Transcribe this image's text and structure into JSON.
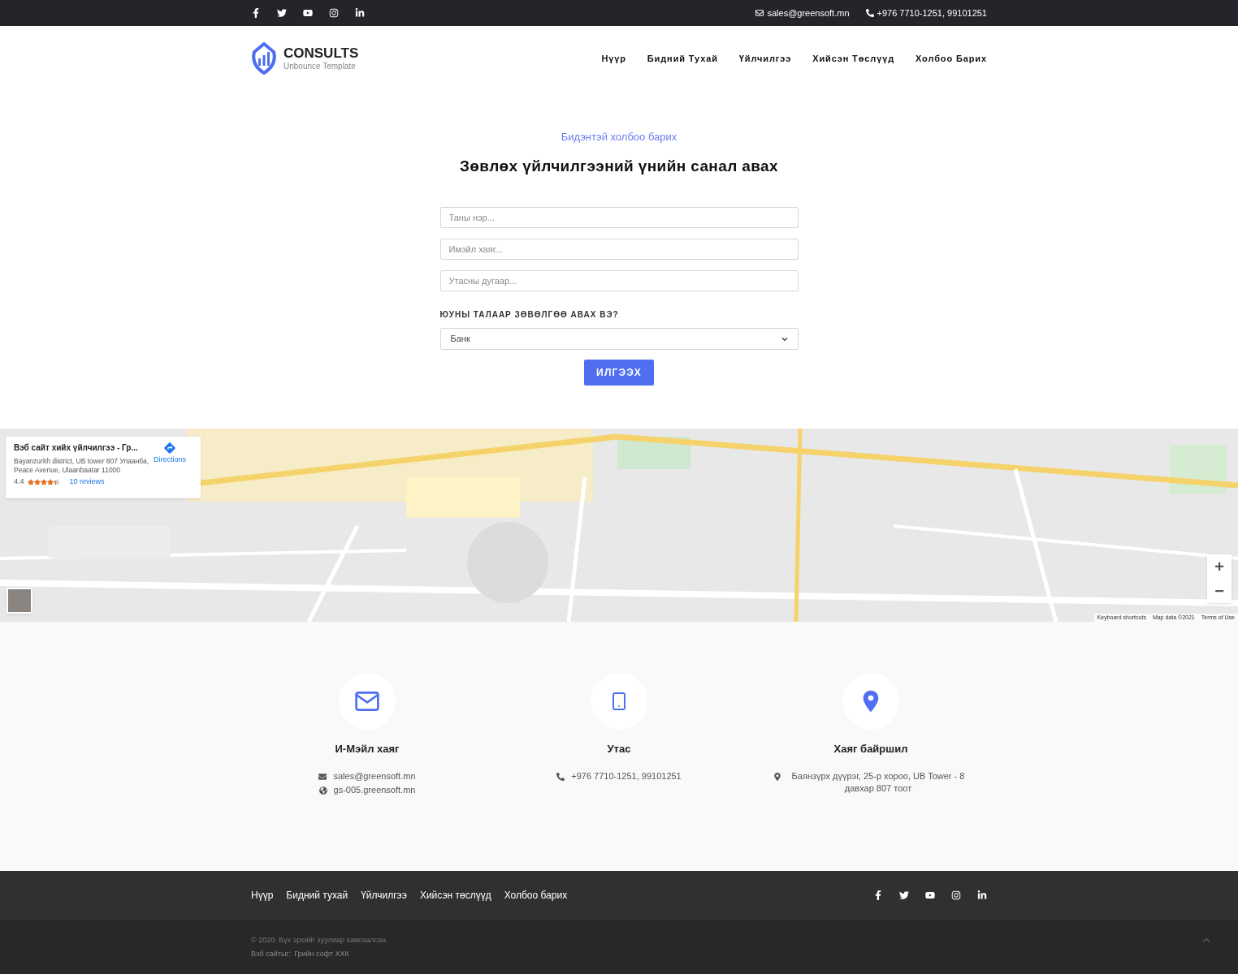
{
  "topbar": {
    "social": [
      {
        "kind": "facebook"
      },
      {
        "kind": "twitter"
      },
      {
        "kind": "youtube"
      },
      {
        "kind": "instagram"
      },
      {
        "kind": "linkedin"
      }
    ],
    "email": "sales@greensoft.mn",
    "phone": "+976 7710-1251, 99101251"
  },
  "header": {
    "logo_title": "CONSULTS",
    "logo_subtitle": "Unbounce Template",
    "nav": [
      "Нүүр",
      "Бидний Тухай",
      "Үйлчилгээ",
      "Хийсэн Төслүүд",
      "Холбоо Барих"
    ]
  },
  "form": {
    "eyebrow": "Бидэнтэй холбоо барих",
    "title": "Зөвлөх үйлчилгээний үнийн санал авах",
    "fields": [
      {
        "placeholder": "Таны нэр..."
      },
      {
        "placeholder": "Имэйл хаяг..."
      },
      {
        "placeholder": "Утасны дугаар..."
      }
    ],
    "select_label": "ЮУНЫ ТАЛААР ЗӨВӨЛГӨӨ АВАХ ВЭ?",
    "select_value": "Банк",
    "submit": "ИЛГЭЭХ"
  },
  "map": {
    "kind": "picture",
    "card": {
      "title": "Вэб сайт хийх үйлчилгээ - Гр...",
      "address": "Bayanzurkh district, UB tower 807 Улаанба, Peace Avenue, Ulaanbaatar 11000",
      "rating": "4.4",
      "stars": 4.4,
      "reviews": "10 reviews",
      "directions": "Directions"
    },
    "zoom_in": "+",
    "zoom_out": "−",
    "attribution": [
      "Keyboard shortcuts",
      "Map data ©2021",
      "Terms of Use"
    ]
  },
  "contacts": [
    {
      "kind": "email",
      "title": "И-Мэйл хаяг",
      "lines": [
        {
          "kind": "email",
          "text": "sales@greensoft.mn"
        },
        {
          "kind": "web",
          "text": "gs-005.greensoft.mn"
        }
      ]
    },
    {
      "kind": "phone",
      "title": "Утас",
      "lines": [
        {
          "kind": "phone",
          "text": "+976 7710-1251, 99101251"
        }
      ]
    },
    {
      "kind": "location",
      "title": "Хаяг байршил",
      "lines": [
        {
          "kind": "location",
          "text": "Баянзүрх дүүрэг, 25-р хороо, UB Tower - 8 давхар 807 тоот"
        }
      ]
    }
  ],
  "footer": {
    "nav": [
      "Нүүр",
      "Бидний тухай",
      "Үйлчилгээ",
      "Хийсэн төслүүд",
      "Холбоо барих"
    ],
    "social": [
      {
        "kind": "facebook"
      },
      {
        "kind": "twitter"
      },
      {
        "kind": "youtube"
      },
      {
        "kind": "instagram"
      },
      {
        "kind": "linkedin"
      }
    ],
    "copyright": "© 2020. Бүх эрхийг хуулиар хамгаалсан.",
    "credit_label": "Вэб сайтыг:",
    "credit_link": "Грийн софт ХХК"
  }
}
